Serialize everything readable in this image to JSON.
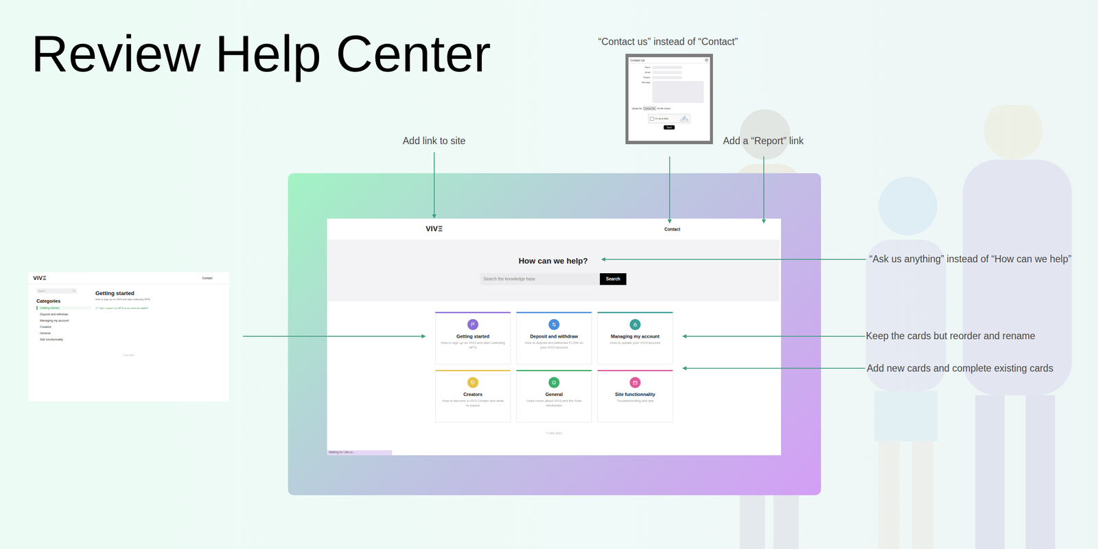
{
  "slide": {
    "title": "Review Help Center"
  },
  "annotations": [
    "“Contact us” instead of “Contact”",
    "Add link to site",
    "Add a “Report” link",
    "“Ask us anything” instead of “How can we help”",
    "Keep the cards but reorder and rename",
    "Add new cards and complete existing cards"
  ],
  "help_center": {
    "logo": "VIVΞ",
    "nav_link": "Contact",
    "heading": "How can we help?",
    "search": {
      "placeholder": "Search the knowledge base",
      "button": "Search"
    },
    "cards": [
      {
        "title": "Getting started",
        "description": "How to sign up on VIV3 and start collecting NFTs",
        "color": "#8b6fd6"
      },
      {
        "title": "Deposit and withdraw",
        "description": "How to deposit and withdraw FLOW on your VIV3 account",
        "color": "#4a8fdc"
      },
      {
        "title": "Managing my account",
        "description": "How to update your VIV3 account",
        "color": "#3a9f98"
      },
      {
        "title": "Creators",
        "description": "How to become a VIV3 Creator and what to expect",
        "color": "#e6c34a"
      },
      {
        "title": "General",
        "description": "Learn more about VIV3 and the Flow blockchain",
        "color": "#3fae6a"
      },
      {
        "title": "Site functionnality",
        "description": "Troubleshooting and tips",
        "color": "#e0599b"
      }
    ],
    "footer": "© Vive 2021",
    "status_bar": "Waiting for i.blk.co..."
  },
  "category_page": {
    "logo": "VIVΞ",
    "nav_link": "Contact",
    "search": {
      "placeholder": "Search"
    },
    "categories_heading": "Categories",
    "categories": [
      {
        "label": "Getting started",
        "selected": true
      },
      {
        "label": "Deposit and withdraw",
        "selected": false
      },
      {
        "label": "Managing my account",
        "selected": false
      },
      {
        "label": "Creators",
        "selected": false
      },
      {
        "label": "General",
        "selected": false
      },
      {
        "label": "Site functionnality",
        "selected": false
      }
    ],
    "article": {
      "title": "Getting started",
      "subtitle": "How to sign up on VIV3 and start collecting NFTs",
      "links": [
        "Can I export my NFTs to an external wallet?"
      ]
    },
    "footer": "© Vive 2021"
  },
  "contact_modal": {
    "title": "Contact Us",
    "fields": [
      {
        "label": "Name",
        "kind": "input"
      },
      {
        "label": "Email",
        "kind": "input"
      },
      {
        "label": "Subject",
        "kind": "input"
      },
      {
        "label": "Message",
        "kind": "textarea"
      }
    ],
    "upload": {
      "label": "Upload file",
      "button": "Choose file",
      "status": "No file chosen"
    },
    "captcha": {
      "label": "I'm not a robot",
      "checked": false,
      "brand": "reCAPTCHA",
      "links": "Privacy - Terms"
    },
    "submit": "Send"
  }
}
